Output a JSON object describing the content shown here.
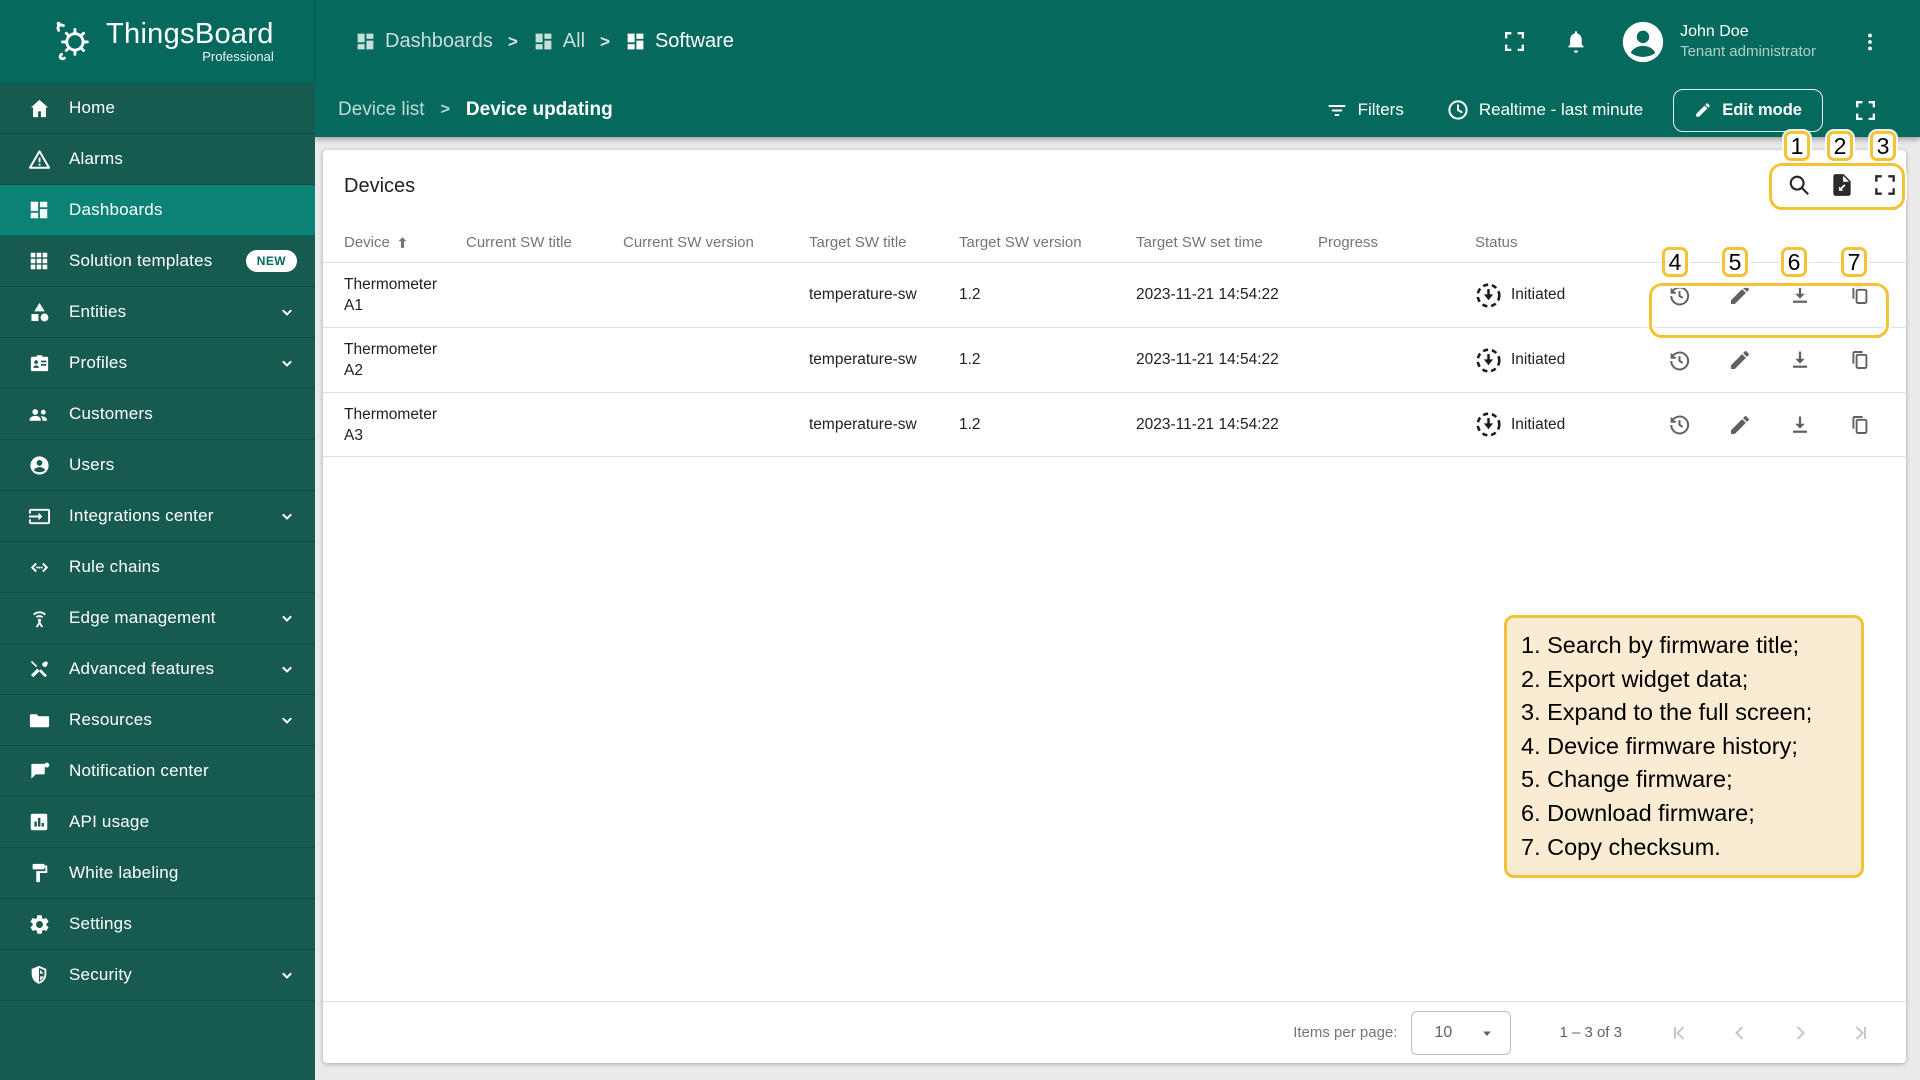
{
  "colors": {
    "header_teal": "#05695D",
    "sidebar_teal": "#175A50",
    "active_item_teal": "#0A8276",
    "dashboard_bg": "#EAEAEA",
    "annotation_yellow": "#F2C237",
    "legend_bg": "#FAECD2",
    "text_dark": "#212121",
    "text_muted": "#757575"
  },
  "brand": {
    "name": "ThingsBoard",
    "edition": "Professional"
  },
  "topbar": {
    "breadcrumbs": [
      "Dashboards",
      "All",
      "Software"
    ],
    "user_name": "John Doe",
    "user_role": "Tenant administrator"
  },
  "toolbar": {
    "parent": "Device list",
    "current": "Device updating",
    "filters": "Filters",
    "realtime": "Realtime - last minute",
    "edit_mode": "Edit mode"
  },
  "sidebar": {
    "items": [
      {
        "label": "Home"
      },
      {
        "label": "Alarms"
      },
      {
        "label": "Dashboards"
      },
      {
        "label": "Solution templates",
        "badge": "NEW"
      },
      {
        "label": "Entities"
      },
      {
        "label": "Profiles"
      },
      {
        "label": "Customers"
      },
      {
        "label": "Users"
      },
      {
        "label": "Integrations center"
      },
      {
        "label": "Rule chains"
      },
      {
        "label": "Edge management"
      },
      {
        "label": "Advanced features"
      },
      {
        "label": "Resources"
      },
      {
        "label": "Notification center"
      },
      {
        "label": "API usage"
      },
      {
        "label": "White labeling"
      },
      {
        "label": "Settings"
      },
      {
        "label": "Security"
      }
    ]
  },
  "widget": {
    "title": "Devices",
    "columns": {
      "device": "Device",
      "current_sw_title": "Current SW title",
      "current_sw_version": "Current SW version",
      "target_sw_title": "Target SW title",
      "target_sw_version": "Target SW version",
      "target_sw_set_time": "Target SW set time",
      "progress": "Progress",
      "status": "Status"
    },
    "rows": [
      {
        "device_line1": "Thermometer",
        "device_line2": "A1",
        "current_sw_title": "",
        "current_sw_version": "",
        "target_sw_title": "temperature-sw",
        "target_sw_version": "1.2",
        "target_sw_set_time": "2023-11-21 14:54:22",
        "progress": "",
        "status": "Initiated"
      },
      {
        "device_line1": "Thermometer",
        "device_line2": "A2",
        "current_sw_title": "",
        "current_sw_version": "",
        "target_sw_title": "temperature-sw",
        "target_sw_version": "1.2",
        "target_sw_set_time": "2023-11-21 14:54:22",
        "progress": "",
        "status": "Initiated"
      },
      {
        "device_line1": "Thermometer",
        "device_line2": "A3",
        "current_sw_title": "",
        "current_sw_version": "",
        "target_sw_title": "temperature-sw",
        "target_sw_version": "1.2",
        "target_sw_set_time": "2023-11-21 14:54:22",
        "progress": "",
        "status": "Initiated"
      }
    ],
    "pagination": {
      "items_per_page_label": "Items per page:",
      "page_size": "10",
      "range": "1 – 3 of 3"
    }
  },
  "annotations": {
    "badges": [
      "1",
      "2",
      "3",
      "4",
      "5",
      "6",
      "7"
    ],
    "legend": [
      "1. Search by firmware title;",
      "2. Export widget data;",
      "3. Expand to the full screen;",
      "4. Device firmware history;",
      "5. Change firmware;",
      "6. Download firmware;",
      "7. Copy checksum."
    ]
  }
}
